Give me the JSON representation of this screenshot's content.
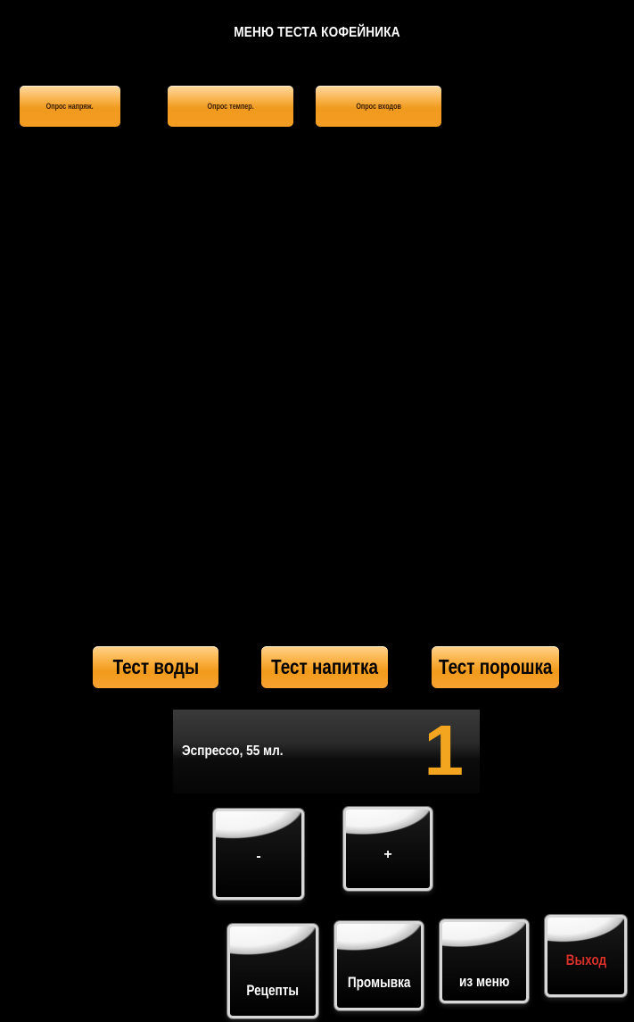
{
  "title": "МЕНЮ ТЕСТА КОФЕЙНИКА",
  "top_buttons": {
    "voltage": "Опрос напряж.",
    "temp": "Опрос темпер.",
    "inputs": "Опрос входов"
  },
  "test_buttons": {
    "water": "Тест воды",
    "drink": "Тест напитка",
    "powder": "Тест порошка"
  },
  "recipe": {
    "name": "Эспрессо, 55 мл.",
    "count": "1"
  },
  "stepper": {
    "minus": "-",
    "plus": "+"
  },
  "bottom_buttons": {
    "recipes": "Рецепты",
    "rinse": "Промывка",
    "exit_menu": "из меню",
    "exit": "Выход"
  },
  "colors": {
    "accent_orange": "#f39c22",
    "count_color": "#f3a51f",
    "exit_red": "#d8322a"
  }
}
